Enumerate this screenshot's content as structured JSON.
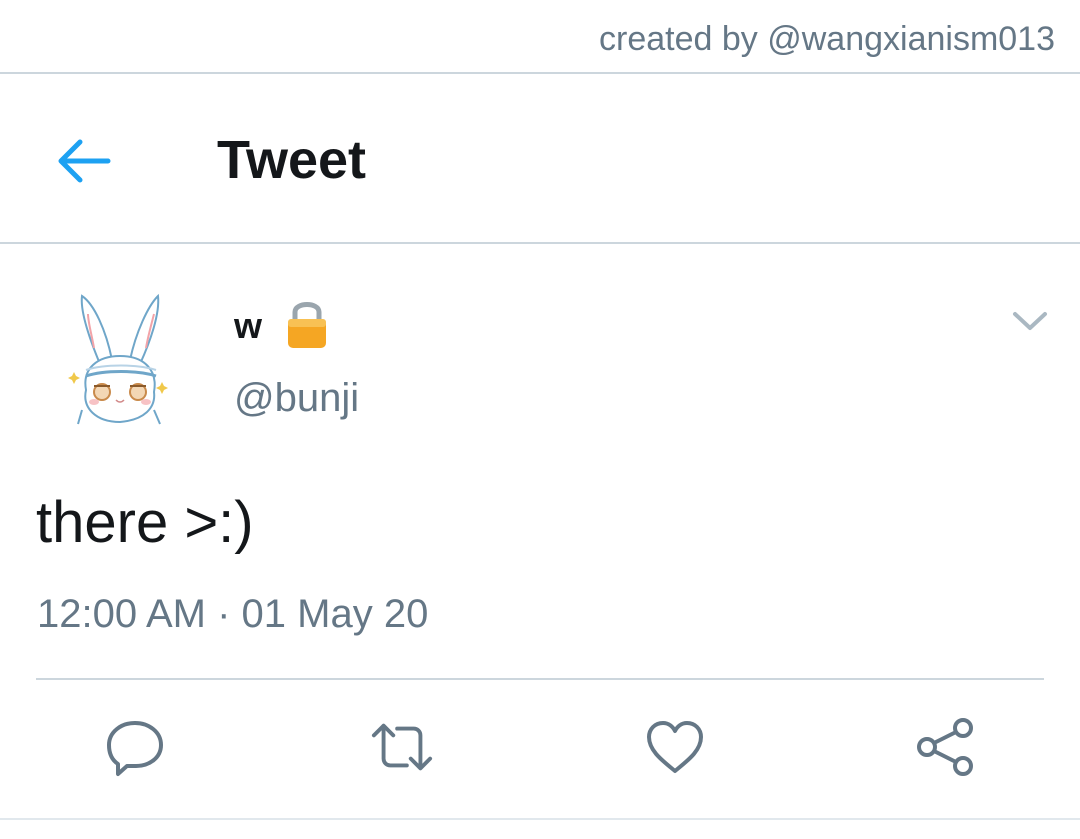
{
  "credit": {
    "text": "created by @wangxianism013"
  },
  "header": {
    "title": "Tweet",
    "back_icon": "arrow-left-icon"
  },
  "colors": {
    "accent": "#1da1f2",
    "muted": "#657786",
    "text": "#14171a",
    "divider": "#ccd6dd",
    "lock": "#f5a623"
  },
  "tweet": {
    "author": {
      "display_name": "w",
      "handle": "@bunji",
      "protected_icon": "lock-icon",
      "avatar_icon": "bunny-avatar"
    },
    "text": "there >:)",
    "timestamp": "12:00 AM · 01 May 20",
    "menu_icon": "chevron-down-icon"
  },
  "actions": [
    {
      "name": "reply",
      "icon": "reply-icon"
    },
    {
      "name": "retweet",
      "icon": "retweet-icon"
    },
    {
      "name": "like",
      "icon": "heart-icon"
    },
    {
      "name": "share",
      "icon": "share-icon"
    }
  ]
}
